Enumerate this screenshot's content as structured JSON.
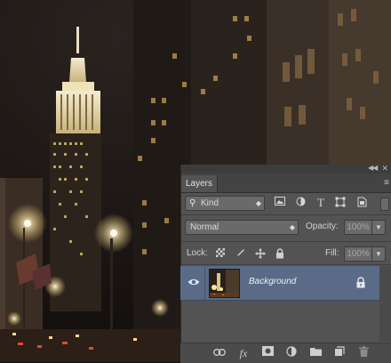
{
  "photo": {
    "description_icon": "city-night-photo"
  },
  "panel": {
    "title": "Layers",
    "collapse_glyph": "◀◀",
    "close_glyph": "✕",
    "menu_glyph": "≡",
    "filter": {
      "label": "Kind",
      "icons": [
        "image-filter-icon",
        "adjustment-filter-icon",
        "type-filter-icon",
        "shape-filter-icon",
        "smart-object-filter-icon"
      ]
    },
    "blend_mode": "Normal",
    "opacity_label": "Opacity:",
    "opacity_value": "100%",
    "lock_label": "Lock:",
    "fill_label": "Fill:",
    "fill_value": "100%",
    "layers": [
      {
        "name": "Background",
        "visible": true,
        "locked": true
      }
    ],
    "bottom_icons": [
      "link-layers-icon",
      "fx-icon",
      "add-mask-icon",
      "adjustment-layer-icon",
      "new-group-icon",
      "new-layer-icon",
      "trash-icon"
    ],
    "fx_text": "fx"
  },
  "colors": {
    "panel_bg": "#535353",
    "selected_layer": "#596b86"
  }
}
